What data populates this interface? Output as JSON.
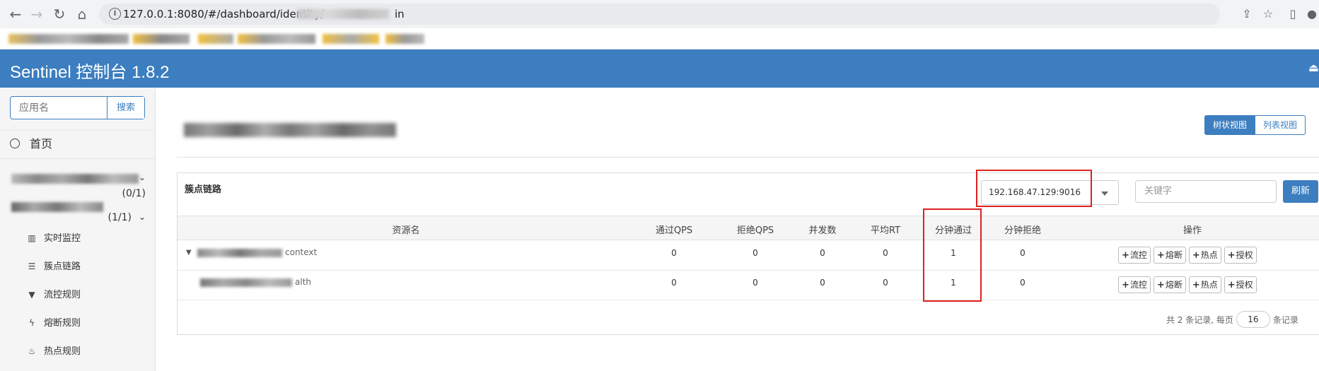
{
  "browser": {
    "url_prefix": "127.0.0.1:8080/#/dashboard/identity/",
    "url_suffix": "in"
  },
  "header": {
    "title": "Sentinel 控制台 1.8.2",
    "logout_icon": "logout-icon"
  },
  "sidebar": {
    "search_placeholder": "应用名",
    "search_button": "搜索",
    "home_label": "首页",
    "apps": [
      {
        "count": "(0/1)"
      },
      {
        "count": "(1/1)"
      }
    ],
    "menu": [
      {
        "label": "实时监控",
        "icon": "bar-chart-icon"
      },
      {
        "label": "簇点链路",
        "icon": "list-icon"
      },
      {
        "label": "流控规则",
        "icon": "filter-icon"
      },
      {
        "label": "熔断规则",
        "icon": "bolt-icon"
      },
      {
        "label": "热点规则",
        "icon": "fire-icon"
      }
    ]
  },
  "main": {
    "view_tree": "树状视图",
    "view_list": "列表视图",
    "panel_title": "簇点链路",
    "machine_selected": "192.168.47.129:9016",
    "keyword_placeholder": "关键字",
    "refresh_button": "刷新",
    "columns": [
      "资源名",
      "通过QPS",
      "拒绝QPS",
      "并发数",
      "平均RT",
      "分钟通过",
      "分钟拒绝",
      "操作"
    ],
    "rows": [
      {
        "resource_suffix": "context",
        "pass_qps": "0",
        "block_qps": "0",
        "concurrency": "0",
        "avg_rt": "0",
        "minute_pass": "1",
        "minute_block": "0"
      },
      {
        "resource_suffix": "alth",
        "pass_qps": "0",
        "block_qps": "0",
        "concurrency": "0",
        "avg_rt": "0",
        "minute_pass": "1",
        "minute_block": "0"
      }
    ],
    "actions": {
      "flow": "流控",
      "degrade": "熔断",
      "hotspot": "热点",
      "auth": "授权"
    },
    "pager": {
      "prefix": "共 2 条记录, 每页",
      "page_size": "16",
      "suffix": "条记录"
    }
  }
}
